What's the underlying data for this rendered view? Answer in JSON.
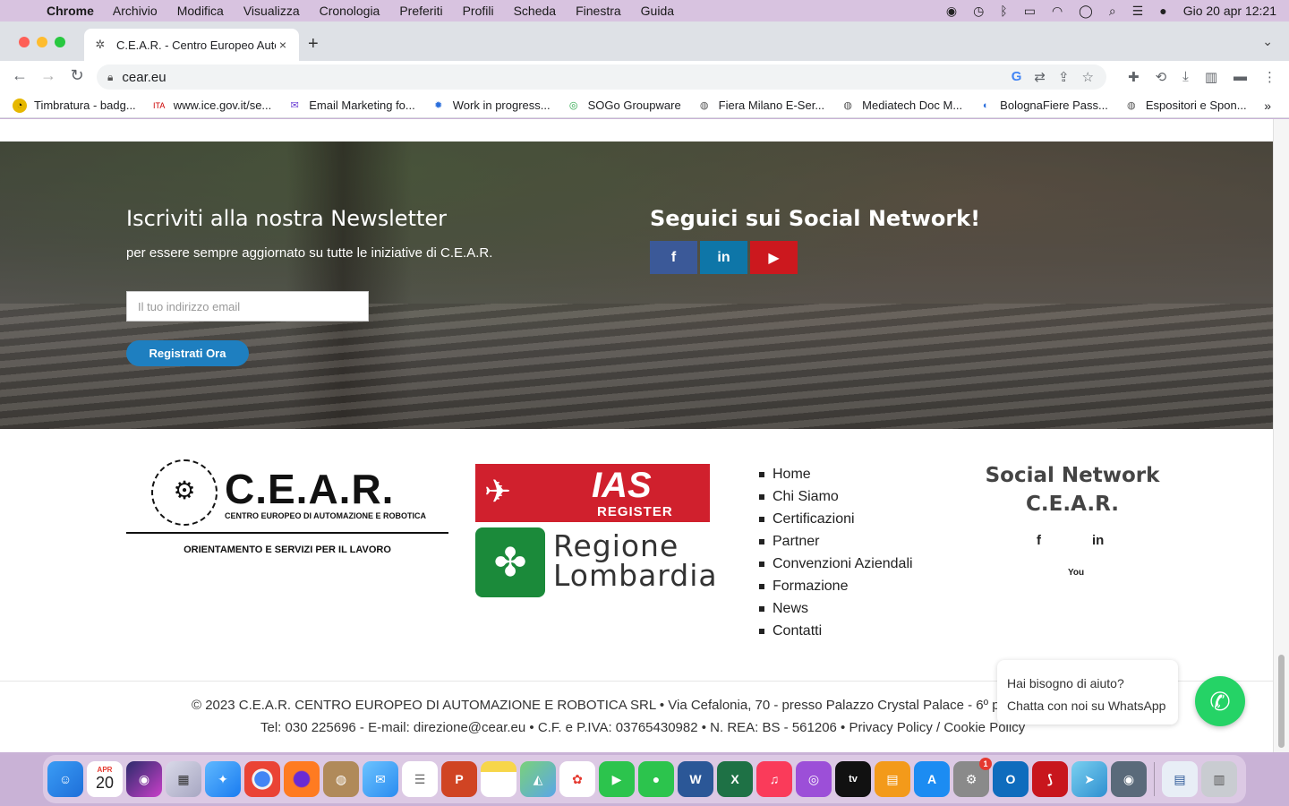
{
  "menubar": {
    "app": "Chrome",
    "items": [
      "Archivio",
      "Modifica",
      "Visualizza",
      "Cronologia",
      "Preferiti",
      "Profili",
      "Scheda",
      "Finestra",
      "Guida"
    ],
    "clock": "Gio 20 apr  12:21"
  },
  "tab": {
    "title": "C.E.A.R. - Centro Europeo Auto",
    "close": "×"
  },
  "newtab": "+",
  "omnibox": {
    "url": "cear.eu"
  },
  "bookmarks": [
    "Timbratura - badg...",
    "www.ice.gov.it/se...",
    "Email Marketing fo...",
    "Work in progress...",
    "SOGo Groupware",
    "Fiera Milano E-Ser...",
    "Mediatech Doc M...",
    "BolognaFiere Pass...",
    "Espositori e Spon..."
  ],
  "newsletter": {
    "title": "Iscriviti alla nostra Newsletter",
    "subtitle": "per essere sempre aggiornato su tutte le iniziative di C.E.A.R.",
    "email_placeholder": "Il tuo indirizzo email",
    "button": "Registrati Ora"
  },
  "social_follow": {
    "title": "Seguici sui Social Network!",
    "facebook": "f",
    "linkedin": "in",
    "youtube": "▶"
  },
  "cear_logo": {
    "brand": "C.E.A.R.",
    "brand_sub": "CENTRO EUROPEO DI AUTOMAZIONE E ROBOTICA",
    "tagline": "ORIENTAMENTO E SERVIZI PER IL LAVORO"
  },
  "ias_logo": {
    "line1": "IAS",
    "line2": "REGISTER"
  },
  "lombardia_logo": {
    "line1": "Regione",
    "line2": "Lombardia"
  },
  "footer_nav": [
    "Home",
    "Chi Siamo",
    "Certificazioni",
    "Partner",
    "Convenzioni Aziendali",
    "Formazione",
    "News",
    "Contatti"
  ],
  "social_network": {
    "title_line1": "Social Network",
    "title_line2": "C.E.A.R.",
    "facebook": "f",
    "linkedin": "in",
    "youtube": "You"
  },
  "copyright": {
    "line1": "© 2023 C.E.A.R. CENTRO EUROPEO DI AUTOMAZIONE E ROBOTICA SRL • Via Cefalonia, 70 - presso Palazzo Crystal Palace - 6º piano, 2",
    "line2": "Tel: 030 225696 - E-mail: direzione@cear.eu • C.F. e P.IVA: 03765430982 • N. REA: BS - 561206 • Privacy Policy / Cookie Policy"
  },
  "whatsapp": {
    "line1": "Hai bisogno di aiuto?",
    "line2": "Chatta con noi su WhatsApp"
  },
  "dock": {
    "calendar_month": "APR",
    "calendar_day": "20",
    "settings_badge": "1"
  }
}
